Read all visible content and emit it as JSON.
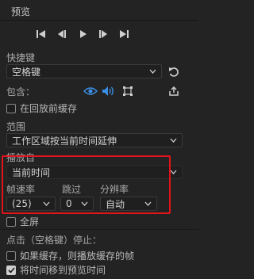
{
  "panel": {
    "title": "预览"
  },
  "transport": {
    "icons": [
      "go-to-start-icon",
      "step-back-icon",
      "play-icon",
      "step-forward-icon",
      "go-to-end-icon"
    ]
  },
  "shortcut": {
    "label": "快捷键",
    "value": "空格键"
  },
  "include": {
    "label": "包含："
  },
  "cache_playback": {
    "label": "在回放前缓存",
    "checked": false
  },
  "range": {
    "label": "范围",
    "value": "工作区域按当前时间延伸"
  },
  "play_from": {
    "label": "播放自",
    "value": "当前时间"
  },
  "frame_rate": {
    "label": "帧速率",
    "value": "(25)"
  },
  "skip": {
    "label": "跳过",
    "value": "0"
  },
  "resolution": {
    "label": "分辨率",
    "value": "自动"
  },
  "fullscreen": {
    "label": "全屏",
    "checked": false
  },
  "click_stop": {
    "label": "点击（空格键）停止："
  },
  "if_cached": {
    "label": "如果缓存，则播放缓存的帧",
    "checked": false
  },
  "move_time": {
    "label": "将时间移到预览时间",
    "checked": true
  },
  "colors": {
    "accent": "#3b8ee6",
    "highlight": "#e0141b",
    "background": "#232323"
  }
}
